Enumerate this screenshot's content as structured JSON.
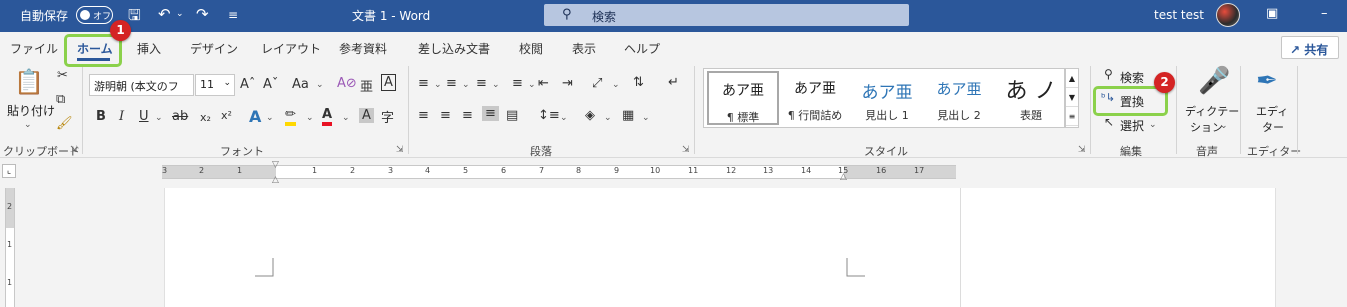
{
  "titlebar": {
    "autosave_label": "自動保存",
    "autosave_state": "オフ",
    "doc_title": "文書 1  -  Word",
    "search_placeholder": "検索",
    "user_name": "test test",
    "bg_color": "#2b579a"
  },
  "tabs": [
    "ファイル",
    "ホーム",
    "挿入",
    "デザイン",
    "レイアウト",
    "参考資料",
    "差し込み文書",
    "校閲",
    "表示",
    "ヘルプ"
  ],
  "active_tab": "ホーム",
  "share_label": "共有",
  "ribbon": {
    "clipboard": {
      "paste_label": "貼り付け",
      "group_label": "クリップボード"
    },
    "font": {
      "font_name": "游明朝 (本文のフ",
      "font_size": "11",
      "change_case": "Aa",
      "group_label": "フォント"
    },
    "paragraph": {
      "group_label": "段落"
    },
    "styles": {
      "items": [
        {
          "preview": "あア亜",
          "name": "¶ 標準"
        },
        {
          "preview": "あア亜",
          "name": "¶ 行間詰め"
        },
        {
          "preview": "あア亜",
          "name": "見出し 1"
        },
        {
          "preview": "あア亜",
          "name": "見出し 2"
        },
        {
          "preview": "あ ノ",
          "name": "表題"
        }
      ],
      "group_label": "スタイル"
    },
    "editing": {
      "find_label": "検索",
      "replace_label": "置換",
      "select_label": "選択",
      "group_label": "編集"
    },
    "voice": {
      "dictate_label_1": "ディクテー",
      "dictate_label_2": "ション",
      "group_label": "音声"
    },
    "editor": {
      "label_1": "エディ",
      "label_2": "ター",
      "group_label": "エディター"
    }
  },
  "badges": [
    "1",
    "2"
  ],
  "highlight_color": "#8bd14b",
  "badge_color": "#d42424",
  "ruler": {
    "h_numbers": [
      "3",
      "2",
      "1",
      "1",
      "2",
      "3",
      "4",
      "5",
      "6",
      "7",
      "8",
      "9",
      "10",
      "11",
      "12",
      "13",
      "14",
      "15",
      "16",
      "17"
    ],
    "v_numbers": [
      "2",
      "1",
      "1"
    ]
  }
}
